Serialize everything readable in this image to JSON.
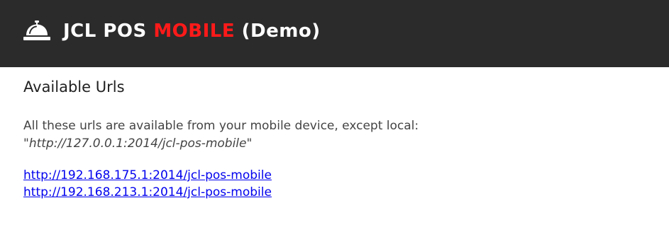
{
  "header": {
    "icon": "service-bell-icon",
    "title_part1": "JCL POS ",
    "title_accent": "MOBILE",
    "title_part2": " (Demo)",
    "background_color": "#2b2b2b",
    "accent_color": "#ff1a1a"
  },
  "main": {
    "heading": "Available Urls",
    "description": "All these urls are available from your mobile device, except local:",
    "local_url": "\"http://127.0.0.1:2014/jcl-pos-mobile\"",
    "urls": [
      "http://192.168.175.1:2014/jcl-pos-mobile",
      "http://192.168.213.1:2014/jcl-pos-mobile"
    ]
  }
}
